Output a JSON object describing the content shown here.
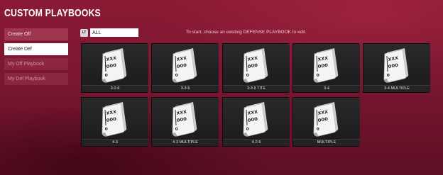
{
  "header": {
    "title": "CUSTOM PLAYBOOKS"
  },
  "sidebar": {
    "items": [
      {
        "label": "Create Off",
        "state": "normal"
      },
      {
        "label": "Create Def",
        "state": "active"
      },
      {
        "label": "My Off Playbook",
        "state": "dim"
      },
      {
        "label": "My Def Playbook",
        "state": "dim"
      }
    ]
  },
  "filter": {
    "button_label": "LT",
    "value": "ALL"
  },
  "instruction": "To start, choose an existing DEFENSE PLAYBOOK to edit.",
  "playbooks": [
    {
      "name": "3-2-6"
    },
    {
      "name": "3-3-5"
    },
    {
      "name": "3-3-5 TITE"
    },
    {
      "name": "3-4"
    },
    {
      "name": "3-4 MULTIPLE"
    },
    {
      "name": "4-3"
    },
    {
      "name": "4-3 MULTIPLE"
    },
    {
      "name": "4-2-5"
    },
    {
      "name": "MULTIPLE"
    }
  ],
  "colors": {
    "background": "#7a1630",
    "card": "#1e1e20",
    "active_button": "#ffffff"
  },
  "icons": {
    "playbook": "playbook-icon",
    "filter_button": "lt-button-icon"
  }
}
